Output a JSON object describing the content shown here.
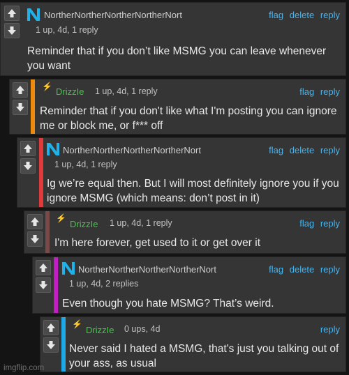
{
  "colors": {
    "bar_1": "#353535",
    "bar_2": "#f08a0e",
    "bar_3": "#e03a3a",
    "bar_4": "#7a4a4a",
    "bar_5": "#c21ec2",
    "bar_6": "#1ea8e6",
    "link": "#4ab2ea",
    "username_green": "#49c24e"
  },
  "comments": [
    {
      "username": "NortherNortherNortherNortherNort",
      "meta": "1 up, 4d, 1 reply",
      "actions": {
        "flag": "flag",
        "delete": "delete",
        "reply": "reply"
      },
      "text": "Reminder that if you don’t like MSMG you can leave whenever you want"
    },
    {
      "username": "DrizzIe",
      "meta": "1 up, 4d, 1 reply",
      "actions": {
        "flag": "flag",
        "reply": "reply"
      },
      "text": "Reminder that if you don't like what I'm posting you can ignore me or block me, or f*** off"
    },
    {
      "username": "NortherNortherNortherNortherNort",
      "meta": "1 up, 4d, 1 reply",
      "actions": {
        "flag": "flag",
        "delete": "delete",
        "reply": "reply"
      },
      "text": "Ig we’re equal then. But I will most definitely ignore you if you ignore MSMG (which means: don’t post in it)"
    },
    {
      "username": "DrizzIe",
      "meta": "1 up, 4d, 1 reply",
      "actions": {
        "flag": "flag",
        "reply": "reply"
      },
      "text": "I'm here forever, get used to it or get over it"
    },
    {
      "username": "NortherNortherNortherNortherNort",
      "meta": "1 up, 4d, 2 replies",
      "actions": {
        "flag": "flag",
        "delete": "delete",
        "reply": "reply"
      },
      "text": "Even though you hate MSMG? That’s weird."
    },
    {
      "username": "DrizzIe",
      "meta": "0 ups, 4d",
      "actions": {
        "reply": "reply"
      },
      "text": "Never said I hated a MSMG, that's just you talking out of your ass, as usual"
    }
  ],
  "watermark": "imgflip.com"
}
